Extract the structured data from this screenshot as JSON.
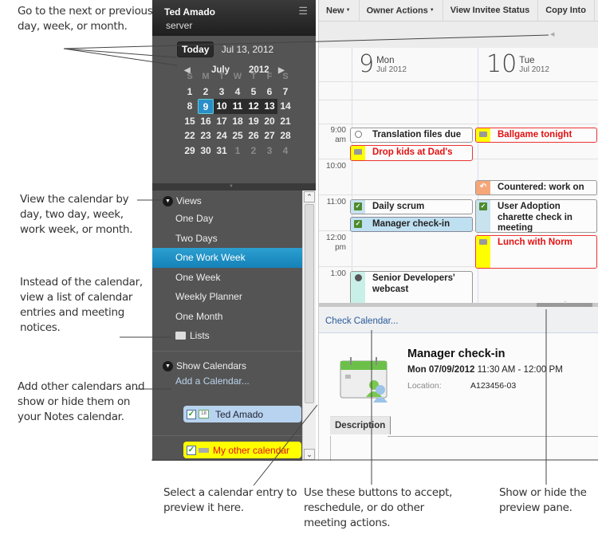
{
  "callouts": {
    "nav": "Go to the next or previous day, week, or month.",
    "views": "View the calendar by day, two day, week, work week, or month.",
    "lists": "Instead of the calendar, view a list of calendar entries and meeting notices.",
    "calendars": "Add other calendars and show or hide them on your Notes calendar.",
    "preview": "Select a calendar entry to preview it here.",
    "actions": "Use these buttons to accept, reschedule, or do other meeting actions.",
    "pane": "Show or hide the preview pane."
  },
  "sidebar": {
    "user": "Ted Amado",
    "server": "server",
    "menu_icon": "hamburger-icon",
    "today_label": "Today",
    "today_date": "Jul 13, 2012",
    "mini_cal": {
      "month": "July",
      "year": "2012",
      "weekdays": [
        "S",
        "M",
        "T",
        "W",
        "T",
        "F",
        "S"
      ],
      "weeks": [
        [
          "1",
          "2",
          "3",
          "4",
          "5",
          "6",
          "7"
        ],
        [
          "8",
          "9",
          "10",
          "11",
          "12",
          "13",
          "14"
        ],
        [
          "15",
          "16",
          "17",
          "18",
          "19",
          "20",
          "21"
        ],
        [
          "22",
          "23",
          "24",
          "25",
          "26",
          "27",
          "28"
        ],
        [
          "29",
          "30",
          "31",
          "1",
          "2",
          "3",
          "4"
        ]
      ],
      "selected_day": "9",
      "today_day": "13"
    },
    "views_label": "Views",
    "views": [
      "One Day",
      "Two Days",
      "One Work Week",
      "One Week",
      "Weekly Planner",
      "One Month"
    ],
    "active_view": "One Work Week",
    "lists_label": "Lists",
    "show_calendars_label": "Show Calendars",
    "add_calendar": "Add a Calendar...",
    "calendars": [
      {
        "name": "Ted Amado",
        "checked": true,
        "color": "#b7d3ef"
      },
      {
        "name": "My other calendar",
        "checked": true,
        "color": "#ffff00"
      }
    ]
  },
  "toolbar": {
    "buttons": [
      "New",
      "Owner Actions",
      "View Invitee Status",
      "Copy Into"
    ]
  },
  "days": [
    {
      "num": "9",
      "name": "Mon",
      "month": "Jul 2012"
    },
    {
      "num": "10",
      "name": "Tue",
      "month": "Jul 2012"
    }
  ],
  "times": [
    {
      "h": "9:00",
      "ampm": "am"
    },
    {
      "h": "10:00",
      "ampm": ""
    },
    {
      "h": "11:00",
      "ampm": ""
    },
    {
      "h": "12:00",
      "ampm": "pm"
    },
    {
      "h": "1:00",
      "ampm": ""
    }
  ],
  "events": [
    {
      "title": "Translation files due",
      "day": 0,
      "icon": "clock-icon"
    },
    {
      "title": "Drop kids at Dad's",
      "day": 0,
      "icon": "calendar-icon"
    },
    {
      "title": "Ballgame tonight",
      "day": 1,
      "icon": "calendar-icon"
    },
    {
      "title": "Countered: work on",
      "day": 1,
      "icon": "undo-icon"
    },
    {
      "title": "Daily scrum",
      "day": 0,
      "icon": "check-icon"
    },
    {
      "title": "Manager check-in",
      "day": 0,
      "icon": "check-icon"
    },
    {
      "title": "User Adoption charette check in meeting",
      "day": 1,
      "icon": "check-icon"
    },
    {
      "title": "Lunch with Norm",
      "day": 1,
      "icon": "calendar-icon"
    },
    {
      "title": "Senior Developers' webcast",
      "day": 0,
      "icon": "clock-icon"
    }
  ],
  "preview": {
    "check_calendar": "Check Calendar...",
    "title": "Manager check-in",
    "date": "Mon 07/09/2012",
    "time": "11:30 AM - 12:00 PM",
    "location_label": "Location:",
    "location": "A123456-03",
    "tab": "Description"
  }
}
